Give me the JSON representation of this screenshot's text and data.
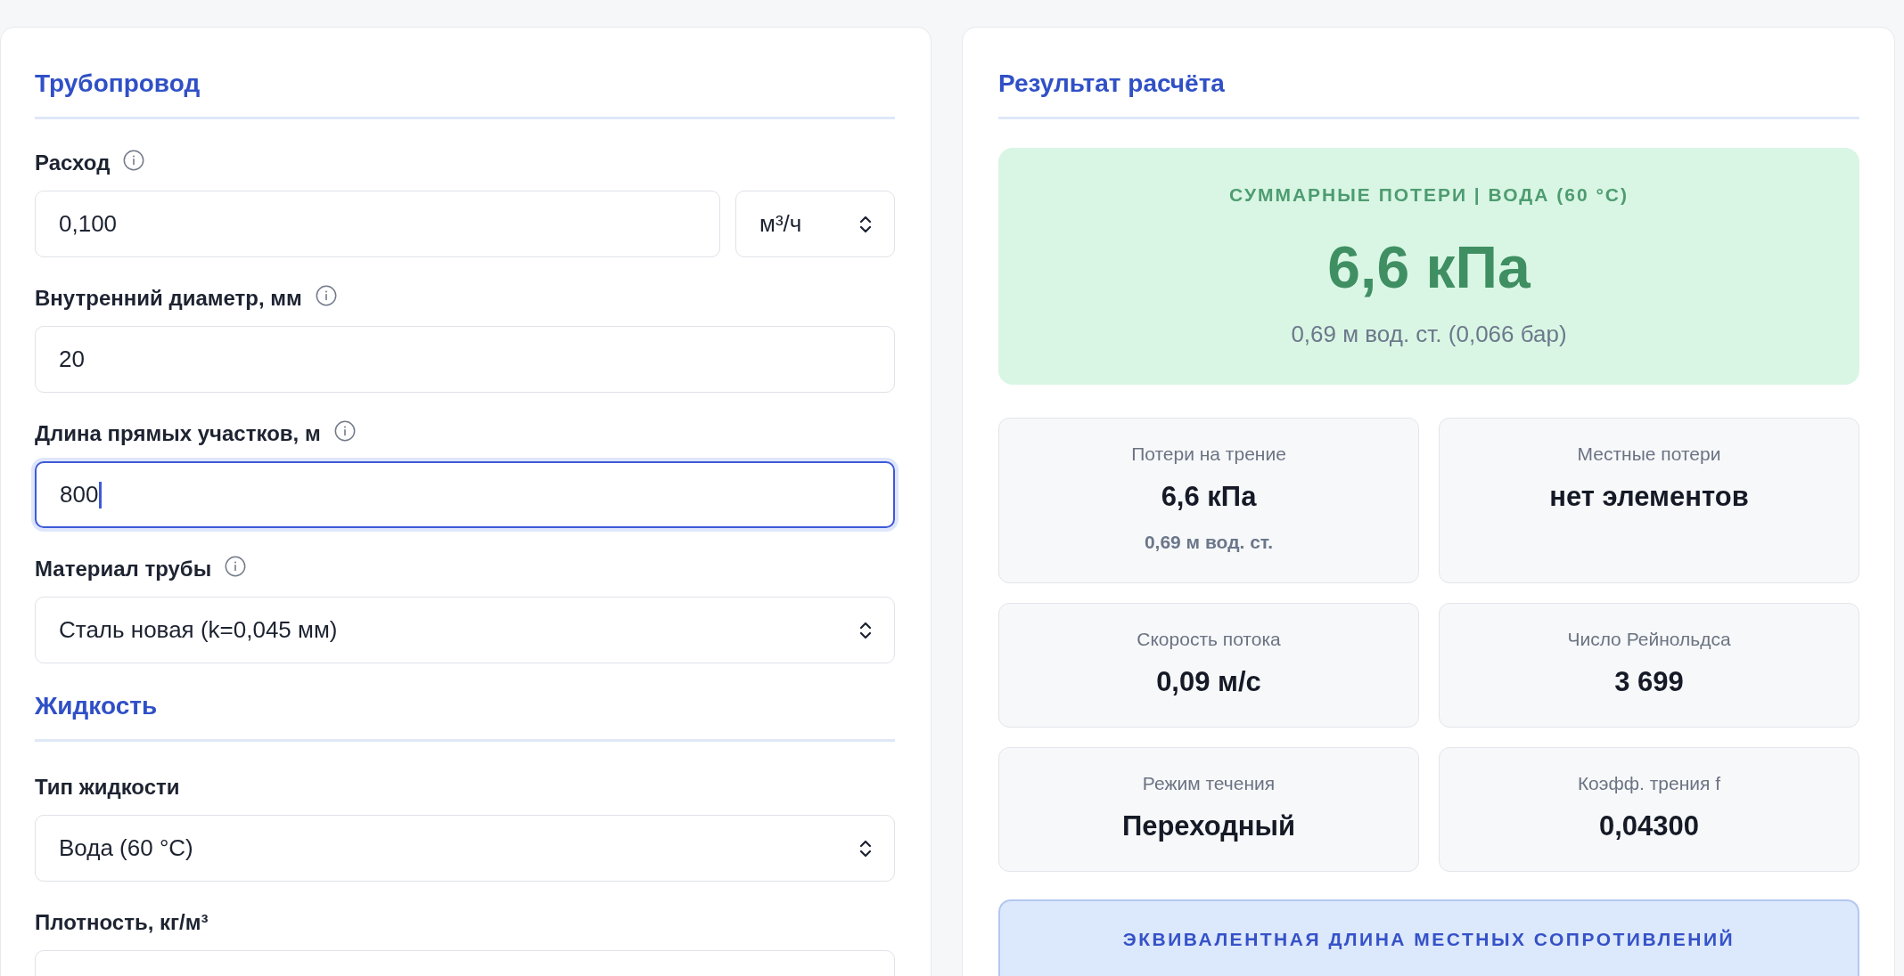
{
  "form": {
    "sections": [
      {
        "title": "Трубопровод",
        "fields": [
          {
            "kind": "input-with-unit",
            "label": "Расход",
            "info": true,
            "value": "0,100",
            "unit": "м³/ч",
            "focused": false
          },
          {
            "kind": "input",
            "label": "Внутренний диаметр, мм",
            "info": true,
            "value": "20",
            "focused": false
          },
          {
            "kind": "input",
            "label": "Длина прямых участков, м",
            "info": true,
            "value": "800",
            "focused": true
          },
          {
            "kind": "select",
            "label": "Материал трубы",
            "info": true,
            "value": "Сталь новая (k=0,045 мм)"
          }
        ]
      },
      {
        "title": "Жидкость",
        "fields": [
          {
            "kind": "select",
            "label": "Тип жидкости",
            "value": "Вода (60 °C)"
          },
          {
            "kind": "input",
            "label": "Плотность, кг/м³",
            "focused": false
          }
        ]
      }
    ]
  },
  "result": {
    "title": "Результат расчёта",
    "summary": {
      "caption": "СУММАРНЫЕ ПОТЕРИ | ВОДА (60 °C)",
      "value": "6,6 кПа",
      "detail": "0,69 м вод. ст. (0,066 бар)"
    },
    "stats": [
      {
        "label": "Потери на трение",
        "value": "6,6 кПа",
        "detail": "0,69 м вод. ст."
      },
      {
        "label": "Местные потери",
        "value": "нет элементов"
      },
      {
        "label": "Скорость потока",
        "value": "0,09 м/с"
      },
      {
        "label": "Число Рейнольдса",
        "value": "3 699"
      },
      {
        "label": "Режим течения",
        "value": "Переходный"
      },
      {
        "label": "Коэфф. трения f",
        "value": "0,04300"
      }
    ],
    "equivalent_length": {
      "caption": "ЭКВИВАЛЕНТНАЯ ДЛИНА МЕСТНЫХ СОПРОТИВЛЕНИЙ"
    }
  }
}
